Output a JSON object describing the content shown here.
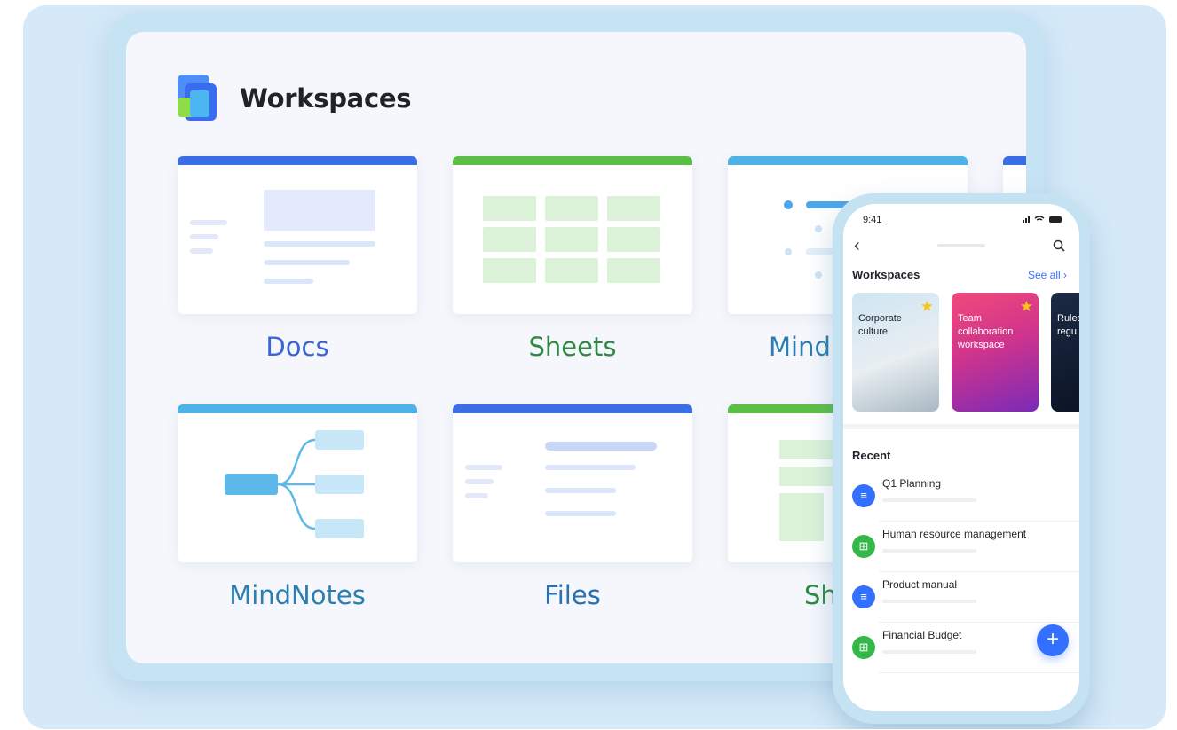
{
  "workspaces": {
    "title": "Workspaces",
    "cards": [
      {
        "label": "Docs",
        "color": "#3b64d4"
      },
      {
        "label": "Sheets",
        "color": "#2e8a43"
      },
      {
        "label": "Mind",
        "color": "#2a7fb0"
      },
      {
        "label": "MindNotes",
        "color": "#2a7fb0"
      },
      {
        "label": "Files",
        "color": "#2a6fb0"
      },
      {
        "label": "Sh",
        "color": "#2e8a43"
      }
    ]
  },
  "colors": {
    "blue_bar": "#3b6ee6",
    "green_bar": "#5cbf45",
    "sky_bar": "#4db2e8",
    "accent": "#3370ff"
  },
  "phone": {
    "time": "9:41",
    "section_title": "Workspaces",
    "see_all": "See all",
    "cards": [
      {
        "label": "Corporate culture",
        "starred": true
      },
      {
        "label": "Team collaboration workspace",
        "starred": true
      },
      {
        "label": "Rules regu",
        "starred": false
      }
    ],
    "recent_title": "Recent",
    "recent": [
      {
        "name": "Q1 Planning",
        "type": "doc",
        "icon": "doc-icon"
      },
      {
        "name": "Human resource management",
        "type": "sheet",
        "icon": "sheet-icon"
      },
      {
        "name": "Product manual",
        "type": "doc",
        "icon": "doc-icon"
      },
      {
        "name": "Financial Budget",
        "type": "sheet",
        "icon": "sheet-icon"
      }
    ],
    "fab": "+"
  }
}
